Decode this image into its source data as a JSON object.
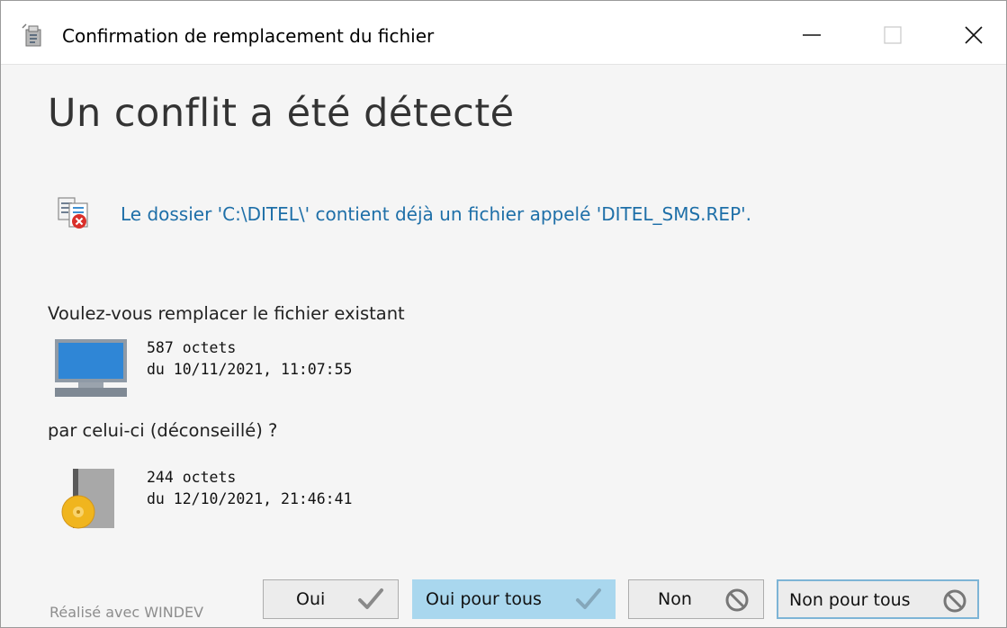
{
  "window": {
    "title": "Confirmation de remplacement du fichier",
    "controls": [
      "minimize",
      "maximize",
      "close"
    ]
  },
  "heading": "Un conflit a été détecté",
  "conflict": {
    "message": "Le dossier 'C:\\DITEL\\' contient déjà un fichier appelé 'DITEL_SMS.REP'.",
    "icon": "file-conflict-icon"
  },
  "existing": {
    "question": "Voulez-vous remplacer le fichier existant",
    "size": "587 octets",
    "date": "du 10/11/2021, 11:07:55",
    "icon": "computer-icon"
  },
  "replacement": {
    "question": "par celui-ci (déconseillé) ?",
    "size": "244 octets",
    "date": "du 12/10/2021, 21:46:41",
    "icon": "install-package-icon"
  },
  "footer": {
    "credit": "Réalisé avec WINDEV"
  },
  "buttons": {
    "yes": "Oui",
    "yes_all": "Oui pour tous",
    "no": "Non",
    "no_all": "Non pour tous"
  },
  "colors": {
    "link_text": "#1e6fa8",
    "primary_button": "#a9d7ee",
    "button_bg": "#ececec"
  }
}
